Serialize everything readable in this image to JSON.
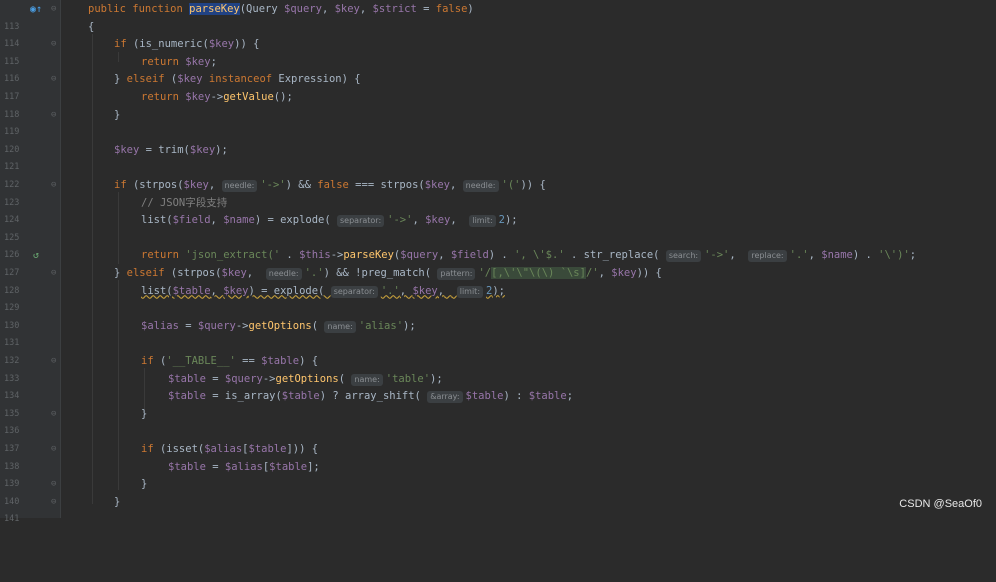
{
  "lines": [
    {
      "n": "113"
    },
    {
      "n": "114"
    },
    {
      "n": "115"
    },
    {
      "n": "116"
    },
    {
      "n": "117"
    },
    {
      "n": "118"
    },
    {
      "n": "119"
    },
    {
      "n": "120"
    },
    {
      "n": "121"
    },
    {
      "n": "122"
    },
    {
      "n": "123"
    },
    {
      "n": "124"
    },
    {
      "n": "125"
    },
    {
      "n": "126"
    },
    {
      "n": "127"
    },
    {
      "n": "128"
    },
    {
      "n": "129"
    },
    {
      "n": "130"
    },
    {
      "n": "131"
    },
    {
      "n": "132"
    },
    {
      "n": "133"
    },
    {
      "n": "134"
    },
    {
      "n": "135"
    },
    {
      "n": "136"
    },
    {
      "n": "137"
    },
    {
      "n": "138"
    },
    {
      "n": "139"
    },
    {
      "n": "140"
    },
    {
      "n": "141"
    }
  ],
  "code": {
    "l113_kw": "public function ",
    "l113_fn": "parseKey",
    "l113_rest1": "(Query ",
    "l113_v1": "$query",
    "l113_c1": ", ",
    "l113_v2": "$key",
    "l113_c2": ", ",
    "l113_v3": "$strict",
    "l113_rest2": " = ",
    "l113_false": "false",
    "l113_end": ")",
    "l114": "{",
    "l115_if": "if ",
    "l115_a": "(is_numeric(",
    "l115_v": "$key",
    "l115_b": ")) {",
    "l116_ret": "return ",
    "l116_v": "$key",
    "l116_end": ";",
    "l117_a": "} ",
    "l117_elseif": "elseif ",
    "l117_b": "(",
    "l117_v": "$key",
    "l117_inst": " instanceof ",
    "l117_c": "Expression) {",
    "l118_ret": "return ",
    "l118_v": "$key",
    "l118_arrow": "->",
    "l118_fn": "getValue",
    "l118_end": "();",
    "l119": "}",
    "l121_v": "$key",
    "l121_a": " = trim(",
    "l121_v2": "$key",
    "l121_b": ");",
    "l123_if": "if ",
    "l123_a": "(strpos(",
    "l123_v": "$key",
    "l123_c": ", ",
    "l123_h1": "needle:",
    "l123_s1": "'->'",
    "l123_d": ") && ",
    "l123_false": "false",
    "l123_e": " === strpos(",
    "l123_v2": "$key",
    "l123_f": ", ",
    "l123_h2": "needle:",
    "l123_s2": "'('",
    "l123_g": ")) {",
    "l124": "// JSON字段支持",
    "l125_a": "list(",
    "l125_v1": "$field",
    "l125_b": ", ",
    "l125_v2": "$name",
    "l125_c": ") = explode( ",
    "l125_h1": "separator:",
    "l125_s1": "'->'",
    "l125_d": ", ",
    "l125_v3": "$key",
    "l125_e": ",  ",
    "l125_h2": "limit:",
    "l125_n": "2",
    "l125_f": ");",
    "l127_ret": "return ",
    "l127_s1": "'json_extract(' ",
    "l127_a": ". ",
    "l127_this": "$this",
    "l127_arrow": "->",
    "l127_fn": "parseKey",
    "l127_b": "(",
    "l127_v1": "$query",
    "l127_c": ", ",
    "l127_v2": "$field",
    "l127_d": ") . ",
    "l127_s2": "', \\'$.'",
    "l127_e": " . str_replace( ",
    "l127_h1": "search:",
    "l127_s3": "'->'",
    "l127_f": ",  ",
    "l127_h2": "replace:",
    "l127_s4": "'.'",
    "l127_g": ", ",
    "l127_v3": "$name",
    "l127_h": ") . ",
    "l127_s5": "'\\')'",
    "l127_end": ";",
    "l128_a": "} ",
    "l128_elseif": "elseif ",
    "l128_b": "(strpos(",
    "l128_v": "$key",
    "l128_c": ",  ",
    "l128_h1": "needle:",
    "l128_s1": "'.'",
    "l128_d": ") && !preg_match( ",
    "l128_h2": "pattern:",
    "l128_s2a": "'/",
    "l128_s2b": "[,\\'\\\"\\(\\) `\\s]",
    "l128_s2c": "/'",
    "l128_e": ", ",
    "l128_v2": "$key",
    "l128_f": ")) {",
    "l129_a": "list(",
    "l129_v1": "$table",
    "l129_b": ", ",
    "l129_v2": "$key",
    "l129_c": ") = explode( ",
    "l129_h1": "separator:",
    "l129_s1": "'.'",
    "l129_d": ", ",
    "l129_v3": "$key",
    "l129_e": ",  ",
    "l129_h2": "limit:",
    "l129_n": "2",
    "l129_f": ");",
    "l131_v": "$alias",
    "l131_a": " = ",
    "l131_v2": "$query",
    "l131_arrow": "->",
    "l131_fn": "getOptions",
    "l131_b": "( ",
    "l131_h": "name:",
    "l131_s": "'alias'",
    "l131_c": ");",
    "l133_if": "if ",
    "l133_a": "(",
    "l133_s": "'__TABLE__'",
    "l133_b": " == ",
    "l133_v": "$table",
    "l133_c": ") {",
    "l134_v": "$table",
    "l134_a": " = ",
    "l134_v2": "$query",
    "l134_arrow": "->",
    "l134_fn": "getOptions",
    "l134_b": "( ",
    "l134_h": "name:",
    "l134_s": "'table'",
    "l134_c": ");",
    "l135_v": "$table",
    "l135_a": " = is_array(",
    "l135_v2": "$table",
    "l135_b": ") ? array_shift( ",
    "l135_h": "&array:",
    "l135_v3": "$table",
    "l135_c": ") : ",
    "l135_v4": "$table",
    "l135_d": ";",
    "l136": "}",
    "l138_if": "if ",
    "l138_a": "(isset(",
    "l138_v": "$alias",
    "l138_b": "[",
    "l138_v2": "$table",
    "l138_c": "])) {",
    "l139_v": "$table",
    "l139_a": " = ",
    "l139_v2": "$alias",
    "l139_b": "[",
    "l139_v3": "$table",
    "l139_c": "];",
    "l140": "}",
    "l141": "}"
  },
  "watermark": "CSDN @SeaOf0",
  "icons": {
    "line113": "override-marker-icon",
    "line127": "recursion-icon"
  }
}
